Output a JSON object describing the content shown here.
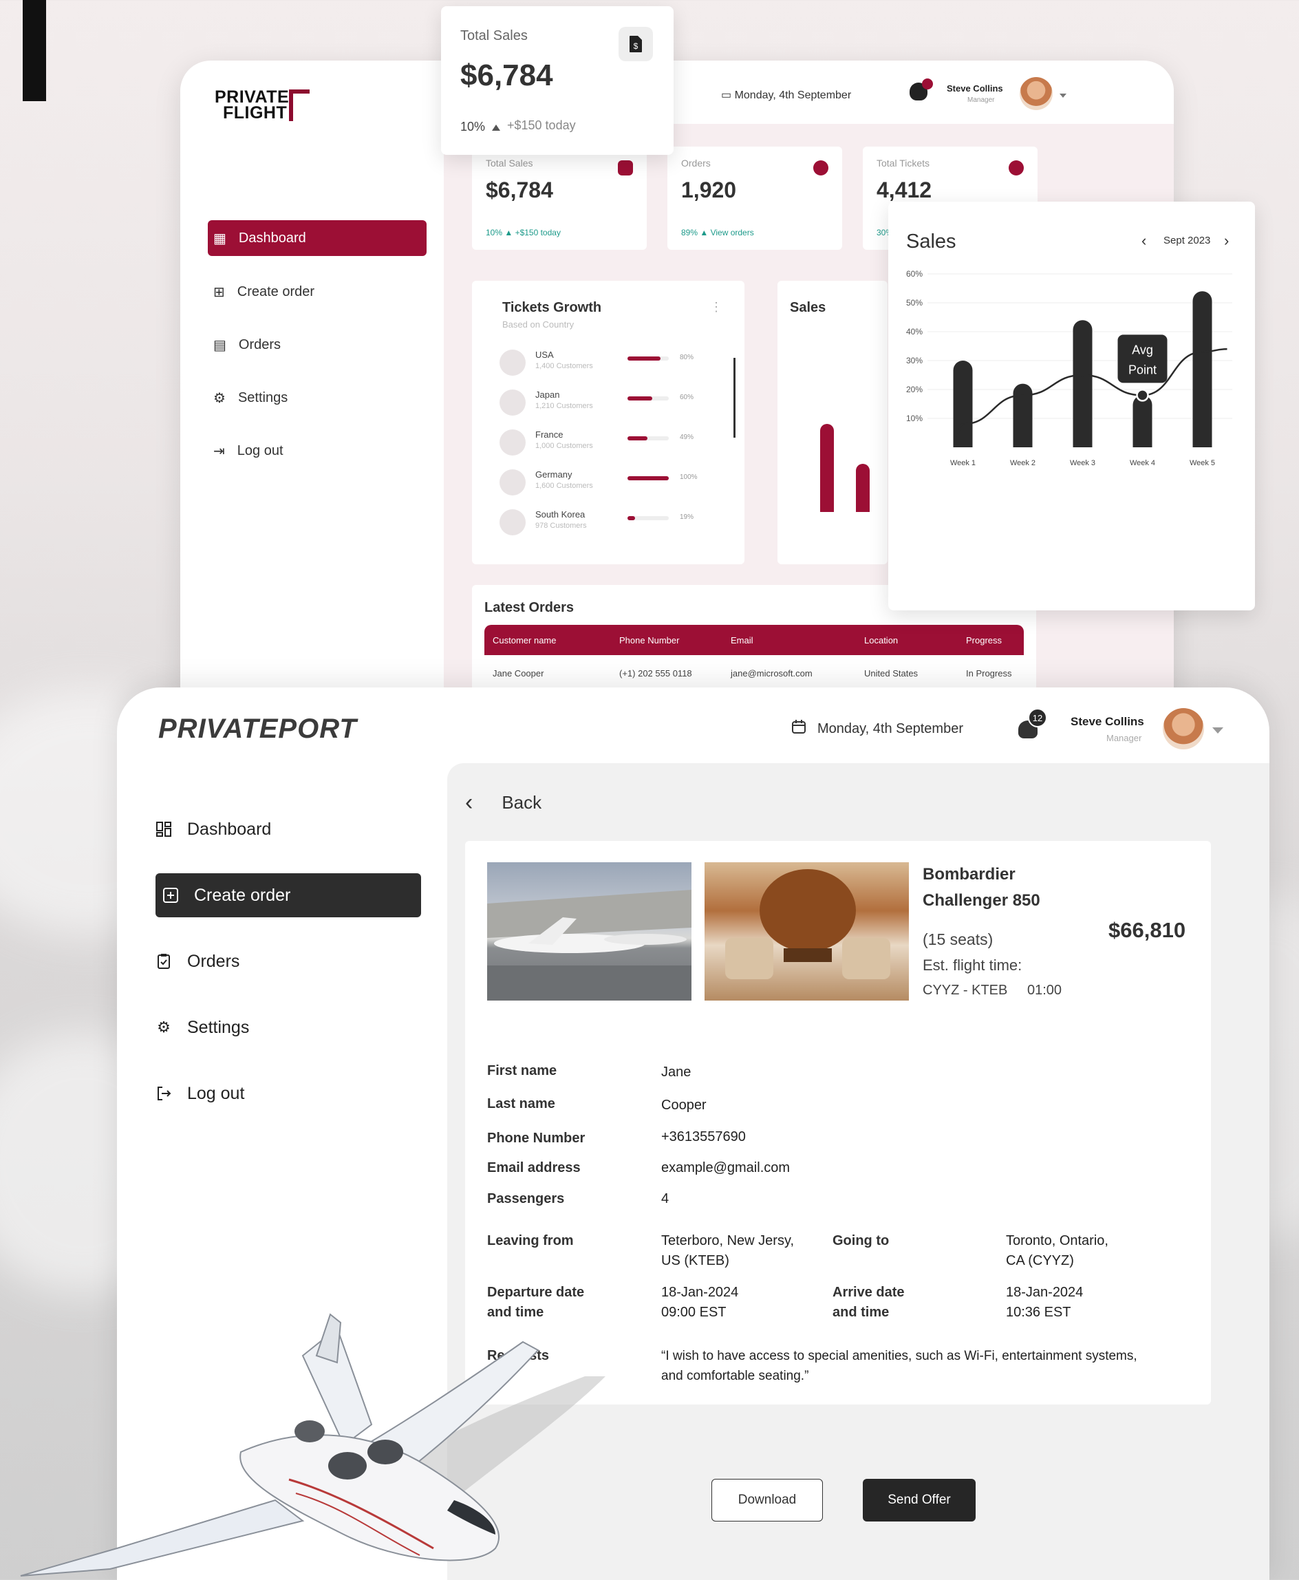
{
  "background_dashboard": {
    "brand": [
      "PRIVATE",
      "FLIGHT"
    ],
    "date": "Monday, 4th September",
    "user": {
      "name": "Steve Collins",
      "role": "Manager"
    },
    "nav": [
      {
        "label": "Dashboard",
        "icon": "dashboard-icon",
        "active": true
      },
      {
        "label": "Create order",
        "icon": "plus-square-icon"
      },
      {
        "label": "Orders",
        "icon": "clipboard-icon"
      },
      {
        "label": "Settings",
        "icon": "gear-icon"
      },
      {
        "label": "Log out",
        "icon": "logout-icon"
      }
    ],
    "stats": [
      {
        "label": "Total Sales",
        "value": "$6,784",
        "sub": "10% ▲ +$150 today"
      },
      {
        "label": "Orders",
        "value": "1,920",
        "sub": "89% ▲ View orders"
      },
      {
        "label": "Total Tickets",
        "value": "4,412",
        "sub": "30%"
      }
    ],
    "tickets_growth": {
      "title": "Tickets Growth",
      "subtitle": "Based on Country",
      "rows": [
        {
          "country": "USA",
          "customers": "1,400 Customers",
          "pct": "80%",
          "level": 0.8
        },
        {
          "country": "Japan",
          "customers": "1,210 Customers",
          "pct": "60%",
          "level": 0.6
        },
        {
          "country": "France",
          "customers": "1,000 Customers",
          "pct": "49%",
          "level": 0.49
        },
        {
          "country": "Germany",
          "customers": "1,600 Customers",
          "pct": "100%",
          "level": 1.0
        },
        {
          "country": "South Korea",
          "customers": "978 Customers",
          "pct": "19%",
          "level": 0.19
        }
      ]
    },
    "mini_sales_title": "Sales",
    "latest_orders": {
      "title": "Latest Orders",
      "columns": [
        "Customer name",
        "Phone Number",
        "Email",
        "Location",
        "Progress"
      ],
      "rows": [
        [
          "Jane Cooper",
          "(+1) 202 555 0118",
          "jane@microsoft.com",
          "United States",
          "In Progress"
        ]
      ]
    }
  },
  "floating_total_sales": {
    "label": "Total Sales",
    "value": "$6,784",
    "pct": "10%",
    "increase": "+$150 today"
  },
  "chart_data": {
    "type": "bar",
    "title": "Sales",
    "period": "Sept 2023",
    "categories": [
      "Week 1",
      "Week 2",
      "Week 3",
      "Week 4",
      "Week 5"
    ],
    "values": [
      30,
      22,
      44,
      18,
      54
    ],
    "trend_line": [
      8,
      18,
      25,
      18,
      33
    ],
    "ylim": [
      0,
      60
    ],
    "yticks": [
      "60%",
      "50%",
      "40%",
      "30%",
      "20%",
      "10%"
    ],
    "ytick_values": [
      60,
      50,
      40,
      30,
      20,
      10
    ],
    "annotation": {
      "text": [
        "Avg",
        "Point"
      ],
      "category": "Week 4"
    },
    "grid": true
  },
  "main": {
    "brand": "PRIVATEPORT",
    "date": "Monday, 4th September",
    "notifications": "12",
    "user": {
      "name": "Steve Collins",
      "role": "Manager"
    },
    "nav": [
      {
        "label": "Dashboard",
        "icon": "dashboard-icon"
      },
      {
        "label": "Create order",
        "icon": "plus-square-icon",
        "active": true
      },
      {
        "label": "Orders",
        "icon": "clipboard-icon"
      },
      {
        "label": "Settings",
        "icon": "gear-icon"
      },
      {
        "label": "Log out",
        "icon": "logout-icon"
      }
    ],
    "back_label": "Back",
    "jet": {
      "name_line1": "Bombardier",
      "name_line2": "Challenger 850",
      "seats": "(15 seats)",
      "est_label": "Est. flight time:",
      "route": "CYYZ - KTEB",
      "time": "01:00",
      "price": "$66,810"
    },
    "fields": {
      "first_name": {
        "label": "First name",
        "value": "Jane"
      },
      "last_name": {
        "label": "Last name",
        "value": "Cooper"
      },
      "phone": {
        "label": "Phone Number",
        "value": "+3613557690"
      },
      "email": {
        "label": "Email address",
        "value": "example@gmail.com"
      },
      "passengers": {
        "label": "Passengers",
        "value": "4"
      },
      "leaving": {
        "label": "Leaving from",
        "value1": "Teterboro, New Jersy,",
        "value2": "US (KTEB)"
      },
      "going": {
        "label": "Going to",
        "value1": "Toronto, Ontario,",
        "value2": "CA (CYYZ)"
      },
      "departure": {
        "label1": "Departure date",
        "label2": "and time",
        "value1": "18-Jan-2024",
        "value2": "09:00 EST"
      },
      "arrive": {
        "label1": "Arrive  date",
        "label2": "and time",
        "value1": "18-Jan-2024",
        "value2": "10:36 EST"
      },
      "requests": {
        "label": "Requests",
        "value1": "“I wish to have access to special amenities, such as Wi-Fi, entertainment systems,",
        "value2": "and comfortable seating.”"
      }
    },
    "buttons": {
      "download": "Download",
      "send_offer": "Send Offer"
    }
  },
  "colors": {
    "accent": "#9c0f35",
    "dark": "#2d2d2d",
    "panel": "#f1f1f1"
  }
}
